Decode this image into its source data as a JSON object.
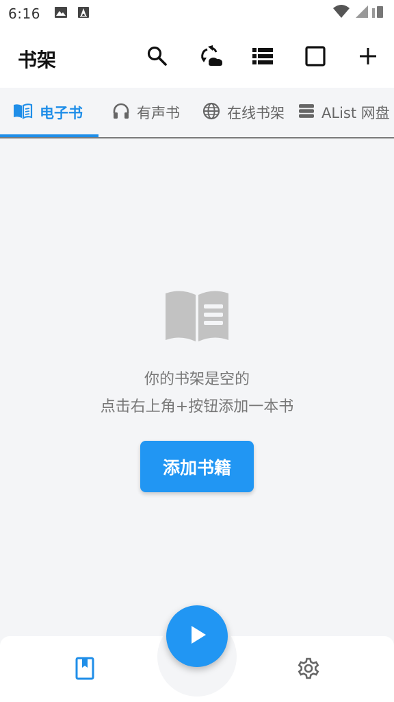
{
  "status_bar": {
    "time": "6:16",
    "left_icons": [
      "image-icon",
      "text-a-icon"
    ],
    "right_icons": [
      "wifi-icon",
      "signal-icon"
    ]
  },
  "appbar": {
    "title": "书架",
    "actions": [
      "search-icon",
      "sync-cloud-icon",
      "list-view-icon",
      "select-square-icon",
      "add-icon"
    ]
  },
  "tabs": [
    {
      "label": "电子书",
      "icon": "book-open-icon",
      "active": true
    },
    {
      "label": "有声书",
      "icon": "headphones-icon",
      "active": false
    },
    {
      "label": "在线书架",
      "icon": "globe-icon",
      "active": false
    },
    {
      "label": "AList 网盘",
      "icon": "server-icon",
      "active": false
    }
  ],
  "empty_state": {
    "icon": "open-book-icon",
    "line1": "你的书架是空的",
    "line2": "点击右上角+按钮添加一本书",
    "button_label": "添加书籍"
  },
  "bottom_nav": {
    "items": [
      "bookshelf-icon",
      "settings-icon"
    ],
    "fab_icon": "play-icon"
  },
  "colors": {
    "accent": "#2196f3",
    "tab_active": "#1f8ee8",
    "background": "#f4f5f7"
  }
}
